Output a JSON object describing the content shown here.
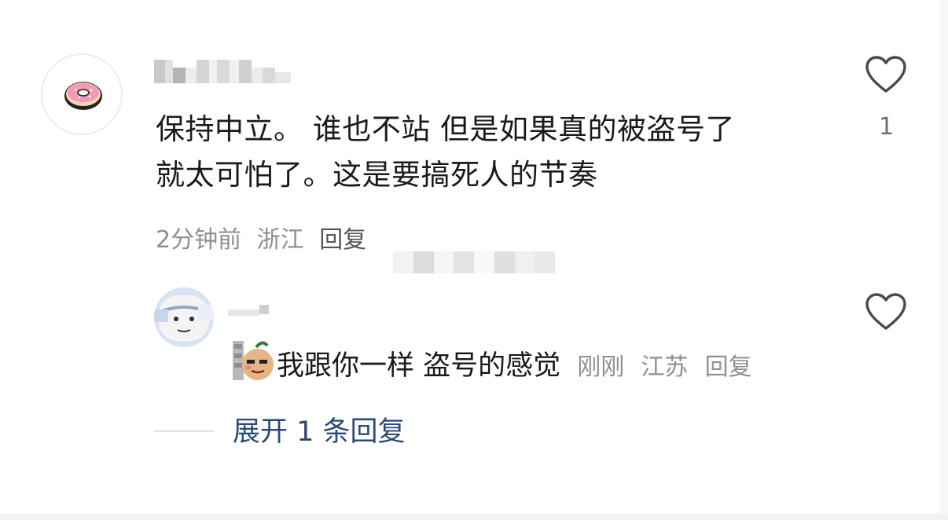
{
  "comment": {
    "text_line1": "保持中立。 谁也不站 但是如果真的被盗号了",
    "text_line2": "就太可怕了。这是要搞死人的节奏",
    "time": "2分钟前",
    "location": "浙江",
    "reply_label": "回复",
    "like_count": "1"
  },
  "reply": {
    "text": "我跟你一样 盗号的感觉",
    "time": "刚刚",
    "location": "江苏",
    "reply_label": "回复"
  },
  "expand": {
    "label": "展开 1 条回复"
  },
  "icons": {
    "like": "heart-outline-icon",
    "avatar": "donut-icon",
    "sticker": "potato-face-sticker"
  },
  "colors": {
    "text": "#1a1a1a",
    "meta": "#8f8f8f",
    "link": "#2c4a74"
  }
}
